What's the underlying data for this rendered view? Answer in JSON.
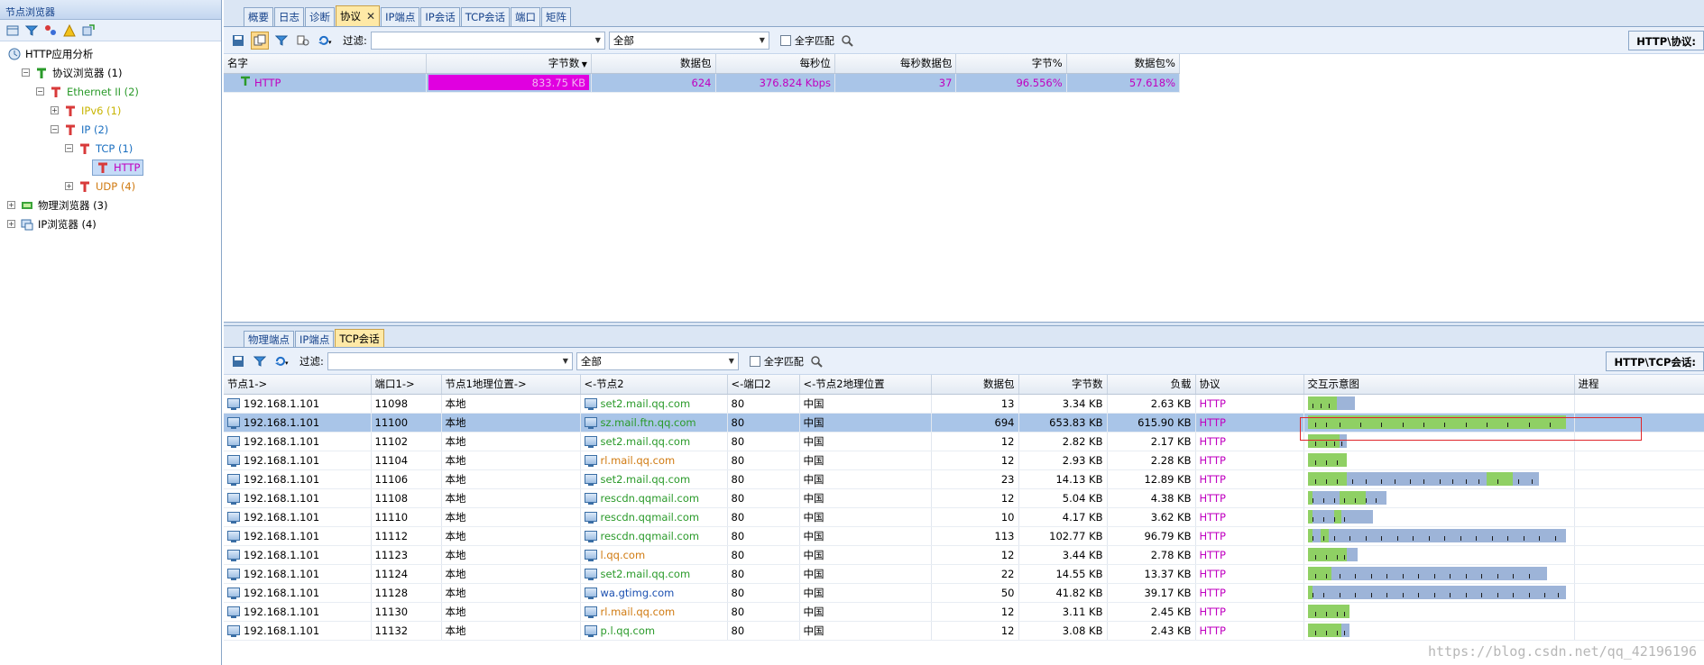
{
  "left_panel": {
    "title": "节点浏览器",
    "toolbar_icons": [
      "new-view-icon",
      "filter-icon",
      "network-icon",
      "alarm-icon",
      "export-icon"
    ],
    "tree": [
      {
        "label": "HTTP应用分析",
        "level": 0,
        "toggle": "",
        "icon": "app-analysis-icon",
        "color": "#000000"
      },
      {
        "label": "协议浏览器 (1)",
        "level": 1,
        "toggle": "−",
        "icon": "protocol-icon",
        "color": "#000000"
      },
      {
        "label": "Ethernet II (2)",
        "level": 2,
        "toggle": "−",
        "icon": "protocol-node-icon",
        "color": "#2a9a2a"
      },
      {
        "label": "IPv6 (1)",
        "level": 3,
        "toggle": "+",
        "icon": "protocol-node-icon",
        "color": "#c8b400"
      },
      {
        "label": "IP (2)",
        "level": 3,
        "toggle": "−",
        "icon": "protocol-node-icon",
        "color": "#1a6fc0"
      },
      {
        "label": "TCP (1)",
        "level": 4,
        "toggle": "−",
        "icon": "protocol-node-icon",
        "color": "#1a6fc0"
      },
      {
        "label": "HTTP",
        "level": 5,
        "toggle": "",
        "icon": "protocol-node-icon",
        "color": "#c000c0",
        "selected": true
      },
      {
        "label": "UDP (4)",
        "level": 4,
        "toggle": "+",
        "icon": "protocol-node-icon",
        "color": "#d07a10"
      },
      {
        "label": "物理浏览器 (3)",
        "level": 0,
        "toggle": "+",
        "icon": "physical-icon",
        "color": "#000000"
      },
      {
        "label": "IP浏览器 (4)",
        "level": 0,
        "toggle": "+",
        "icon": "ip-browser-icon",
        "color": "#000000"
      }
    ]
  },
  "top": {
    "tabs": [
      {
        "label": "概要",
        "active": false
      },
      {
        "label": "日志",
        "active": false
      },
      {
        "label": "诊断",
        "active": false
      },
      {
        "label": "协议",
        "active": true
      },
      {
        "label": "IP端点",
        "active": false
      },
      {
        "label": "IP会话",
        "active": false
      },
      {
        "label": "TCP会话",
        "active": false
      },
      {
        "label": "端口",
        "active": false
      },
      {
        "label": "矩阵",
        "active": false
      }
    ],
    "filter_label": "过滤:",
    "filter_value": "",
    "scope_value": "全部",
    "full_match_label": "全字匹配",
    "panel_title": "HTTP\\协议:",
    "columns": [
      "名字",
      "字节数",
      "数据包",
      "每秒位",
      "每秒数据包",
      "字节%",
      "数据包%"
    ],
    "row": {
      "name": "HTTP",
      "bytes": "833.75 KB",
      "packets": "624",
      "bps": "376.824 Kbps",
      "pps": "37",
      "bytes_pct": "96.556%",
      "packets_pct": "57.618%"
    }
  },
  "bottom": {
    "tabs": [
      {
        "label": "物理端点",
        "active": false
      },
      {
        "label": "IP端点",
        "active": false
      },
      {
        "label": "TCP会话",
        "active": true
      }
    ],
    "filter_label": "过滤:",
    "filter_value": "",
    "scope_value": "全部",
    "full_match_label": "全字匹配",
    "panel_title": "HTTP\\TCP会话:",
    "columns": [
      "节点1->",
      "端口1->",
      "节点1地理位置->",
      "<-节点2",
      "<-端口2",
      "<-节点2地理位置",
      "数据包",
      "字节数",
      "负载",
      "协议",
      "交互示意图",
      "进程"
    ],
    "rows": [
      {
        "n1": "192.168.1.101",
        "p1": "11098",
        "g1": "本地",
        "n2": "set2.mail.qq.com",
        "n2color": "#2a9a2a",
        "p2": "80",
        "g2": "中国",
        "pk": "13",
        "by": "3.34 KB",
        "ld": "2.63 KB",
        "proto": "HTTP",
        "bar_total": 0.18,
        "bar_segments": [
          {
            "w": 0.11,
            "c": "#8fd064"
          },
          {
            "w": 0.07,
            "c": "#9db4d8"
          }
        ],
        "ticks": [
          0.02,
          0.05,
          0.08
        ],
        "selected": false
      },
      {
        "n1": "192.168.1.101",
        "p1": "11100",
        "g1": "本地",
        "n2": "sz.mail.ftn.qq.com",
        "n2color": "#2a9a2a",
        "p2": "80",
        "g2": "中国",
        "pk": "694",
        "by": "653.83 KB",
        "ld": "615.90 KB",
        "proto": "HTTP",
        "bar_total": 0.98,
        "bar_segments": [
          {
            "w": 0.98,
            "c": "#8fd064"
          }
        ],
        "ticks": [
          0.03,
          0.07,
          0.12,
          0.2,
          0.28,
          0.36,
          0.44,
          0.52,
          0.6,
          0.68,
          0.76,
          0.84,
          0.92
        ],
        "selected": true
      },
      {
        "n1": "192.168.1.101",
        "p1": "11102",
        "g1": "本地",
        "n2": "set2.mail.qq.com",
        "n2color": "#2a9a2a",
        "p2": "80",
        "g2": "中国",
        "pk": "12",
        "by": "2.82 KB",
        "ld": "2.17 KB",
        "proto": "HTTP",
        "bar_total": 0.15,
        "bar_segments": [
          {
            "w": 0.12,
            "c": "#8fd064"
          },
          {
            "w": 0.03,
            "c": "#9db4d8"
          }
        ],
        "ticks": [
          0.03,
          0.07,
          0.1,
          0.13
        ],
        "selected": false
      },
      {
        "n1": "192.168.1.101",
        "p1": "11104",
        "g1": "本地",
        "n2": "rl.mail.qq.com",
        "n2color": "#d07a10",
        "p2": "80",
        "g2": "中国",
        "pk": "12",
        "by": "2.93 KB",
        "ld": "2.28 KB",
        "proto": "HTTP",
        "bar_total": 0.15,
        "bar_segments": [
          {
            "w": 0.15,
            "c": "#8fd064"
          }
        ],
        "ticks": [
          0.03,
          0.07,
          0.11
        ],
        "selected": false
      },
      {
        "n1": "192.168.1.101",
        "p1": "11106",
        "g1": "本地",
        "n2": "set2.mail.qq.com",
        "n2color": "#2a9a2a",
        "p2": "80",
        "g2": "中国",
        "pk": "23",
        "by": "14.13 KB",
        "ld": "12.89 KB",
        "proto": "HTTP",
        "bar_total": 0.88,
        "bar_segments": [
          {
            "w": 0.15,
            "c": "#8fd064"
          },
          {
            "w": 0.53,
            "c": "#9db4d8"
          },
          {
            "w": 0.1,
            "c": "#8fd064"
          },
          {
            "w": 0.1,
            "c": "#9db4d8"
          }
        ],
        "ticks": [
          0.03,
          0.07,
          0.11,
          0.17,
          0.22,
          0.28,
          0.33,
          0.39,
          0.44,
          0.5,
          0.55,
          0.6,
          0.65,
          0.72,
          0.8,
          0.85
        ],
        "selected": false
      },
      {
        "n1": "192.168.1.101",
        "p1": "11108",
        "g1": "本地",
        "n2": "rescdn.qqmail.com",
        "n2color": "#2a9a2a",
        "p2": "80",
        "g2": "中国",
        "pk": "12",
        "by": "5.04 KB",
        "ld": "4.38 KB",
        "proto": "HTTP",
        "bar_total": 0.3,
        "bar_segments": [
          {
            "w": 0.02,
            "c": "#8fd064"
          },
          {
            "w": 0.1,
            "c": "#9db4d8"
          },
          {
            "w": 0.1,
            "c": "#8fd064"
          },
          {
            "w": 0.08,
            "c": "#9db4d8"
          }
        ],
        "ticks": [
          0.02,
          0.06,
          0.1,
          0.14,
          0.18,
          0.22,
          0.26
        ],
        "selected": false
      },
      {
        "n1": "192.168.1.101",
        "p1": "11110",
        "g1": "本地",
        "n2": "rescdn.qqmail.com",
        "n2color": "#2a9a2a",
        "p2": "80",
        "g2": "中国",
        "pk": "10",
        "by": "4.17 KB",
        "ld": "3.62 KB",
        "proto": "HTTP",
        "bar_total": 0.25,
        "bar_segments": [
          {
            "w": 0.02,
            "c": "#8fd064"
          },
          {
            "w": 0.08,
            "c": "#9db4d8"
          },
          {
            "w": 0.03,
            "c": "#8fd064"
          },
          {
            "w": 0.12,
            "c": "#9db4d8"
          }
        ],
        "ticks": [
          0.02,
          0.06,
          0.1,
          0.14
        ],
        "selected": false
      },
      {
        "n1": "192.168.1.101",
        "p1": "11112",
        "g1": "本地",
        "n2": "rescdn.qqmail.com",
        "n2color": "#2a9a2a",
        "p2": "80",
        "g2": "中国",
        "pk": "113",
        "by": "102.77 KB",
        "ld": "96.79 KB",
        "proto": "HTTP",
        "bar_total": 0.98,
        "bar_segments": [
          {
            "w": 0.02,
            "c": "#8fd064"
          },
          {
            "w": 0.03,
            "c": "#9db4d8"
          },
          {
            "w": 0.03,
            "c": "#8fd064"
          },
          {
            "w": 0.9,
            "c": "#9db4d8"
          }
        ],
        "ticks": [
          0.02,
          0.06,
          0.1,
          0.16,
          0.22,
          0.28,
          0.34,
          0.4,
          0.46,
          0.52,
          0.58,
          0.64,
          0.7,
          0.76,
          0.82,
          0.88,
          0.94
        ],
        "selected": false
      },
      {
        "n1": "192.168.1.101",
        "p1": "11123",
        "g1": "本地",
        "n2": "l.qq.com",
        "n2color": "#d07a10",
        "p2": "80",
        "g2": "中国",
        "pk": "12",
        "by": "3.44 KB",
        "ld": "2.78 KB",
        "proto": "HTTP",
        "bar_total": 0.19,
        "bar_segments": [
          {
            "w": 0.15,
            "c": "#8fd064"
          },
          {
            "w": 0.04,
            "c": "#9db4d8"
          }
        ],
        "ticks": [
          0.03,
          0.07,
          0.11,
          0.14
        ],
        "selected": false
      },
      {
        "n1": "192.168.1.101",
        "p1": "11124",
        "g1": "本地",
        "n2": "set2.mail.qq.com",
        "n2color": "#2a9a2a",
        "p2": "80",
        "g2": "中国",
        "pk": "22",
        "by": "14.55 KB",
        "ld": "13.37 KB",
        "proto": "HTTP",
        "bar_total": 0.91,
        "bar_segments": [
          {
            "w": 0.09,
            "c": "#8fd064"
          },
          {
            "w": 0.82,
            "c": "#9db4d8"
          }
        ],
        "ticks": [
          0.03,
          0.07,
          0.12,
          0.18,
          0.24,
          0.3,
          0.36,
          0.42,
          0.48,
          0.54,
          0.6,
          0.66,
          0.72,
          0.78,
          0.84
        ],
        "selected": false
      },
      {
        "n1": "192.168.1.101",
        "p1": "11128",
        "g1": "本地",
        "n2": "wa.gtimg.com",
        "n2color": "#1a4fb0",
        "p2": "80",
        "g2": "中国",
        "pk": "50",
        "by": "41.82 KB",
        "ld": "39.17 KB",
        "proto": "HTTP",
        "bar_total": 0.98,
        "bar_segments": [
          {
            "w": 0.02,
            "c": "#8fd064"
          },
          {
            "w": 0.96,
            "c": "#9db4d8"
          }
        ],
        "ticks": [
          0.02,
          0.06,
          0.12,
          0.18,
          0.24,
          0.3,
          0.36,
          0.42,
          0.48,
          0.54,
          0.6,
          0.66,
          0.72,
          0.78,
          0.84,
          0.9,
          0.95
        ],
        "selected": false
      },
      {
        "n1": "192.168.1.101",
        "p1": "11130",
        "g1": "本地",
        "n2": "rl.mail.qq.com",
        "n2color": "#d07a10",
        "p2": "80",
        "g2": "中国",
        "pk": "12",
        "by": "3.11 KB",
        "ld": "2.45 KB",
        "proto": "HTTP",
        "bar_total": 0.16,
        "bar_segments": [
          {
            "w": 0.16,
            "c": "#8fd064"
          }
        ],
        "ticks": [
          0.03,
          0.07,
          0.11,
          0.14
        ],
        "selected": false
      },
      {
        "n1": "192.168.1.101",
        "p1": "11132",
        "g1": "本地",
        "n2": "p.l.qq.com",
        "n2color": "#2a9a2a",
        "p2": "80",
        "g2": "中国",
        "pk": "12",
        "by": "3.08 KB",
        "ld": "2.43 KB",
        "proto": "HTTP",
        "bar_total": 0.16,
        "bar_segments": [
          {
            "w": 0.13,
            "c": "#8fd064"
          },
          {
            "w": 0.03,
            "c": "#9db4d8"
          }
        ],
        "ticks": [
          0.03,
          0.07,
          0.11,
          0.14
        ],
        "selected": false
      }
    ]
  },
  "watermark": "https://blog.csdn.net/qq_42196196",
  "colors": {
    "accent": "#c000c0",
    "selected_row": "#a9c5e8",
    "bar_green": "#8fd064",
    "bar_blue": "#9db4d8",
    "highlight_box": "#e0262a"
  }
}
